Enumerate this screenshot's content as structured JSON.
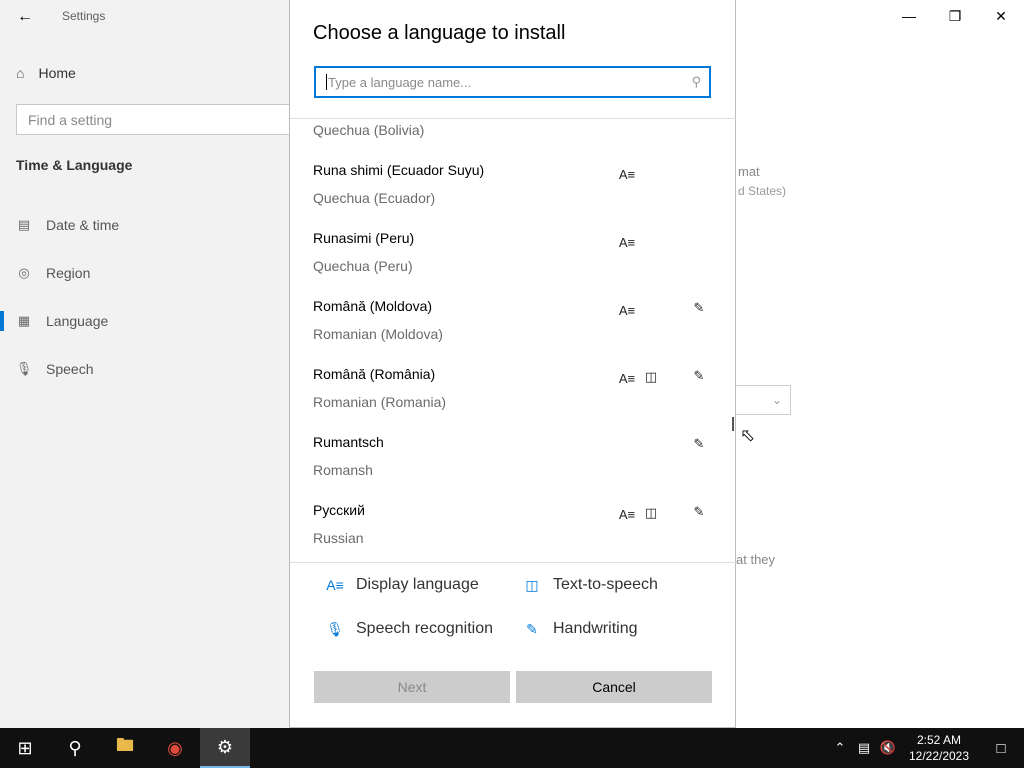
{
  "settings_window": {
    "title": "Settings",
    "nav_home": "Home",
    "search_placeholder": "Find a setting",
    "section_title": "Time & Language",
    "nav_items": [
      {
        "label": "Date & time",
        "icon": "calendar-clock-icon"
      },
      {
        "label": "Region",
        "icon": "globe-icon"
      },
      {
        "label": "Language",
        "icon": "language-icon",
        "selected": true
      },
      {
        "label": "Speech",
        "icon": "microphone-icon"
      }
    ],
    "background_fragments": {
      "format_text": "mat",
      "format_sub": "d States)",
      "body_text": "at they"
    }
  },
  "dialog": {
    "title": "Choose a language to install",
    "search_placeholder": "Type a language name...",
    "partial_item_english": "Quechua (Bolivia)",
    "languages": [
      {
        "native": "Runa shimi (Ecuador Suyu)",
        "english": "Quechua (Ecuador)",
        "display": true,
        "tts": false,
        "handwriting": false
      },
      {
        "native": "Runasimi (Peru)",
        "english": "Quechua (Peru)",
        "display": true,
        "tts": false,
        "handwriting": false
      },
      {
        "native": "Română (Moldova)",
        "english": "Romanian (Moldova)",
        "display": true,
        "tts": false,
        "handwriting": true
      },
      {
        "native": "Română (România)",
        "english": "Romanian (Romania)",
        "display": true,
        "tts": true,
        "handwriting": true
      },
      {
        "native": "Rumantsch",
        "english": "Romansh",
        "display": false,
        "tts": false,
        "handwriting": true
      },
      {
        "native": "Русский",
        "english": "Russian",
        "display": true,
        "tts": true,
        "handwriting": true
      }
    ],
    "legend": {
      "display_language": "Display language",
      "text_to_speech": "Text-to-speech",
      "speech_recognition": "Speech recognition",
      "handwriting": "Handwriting"
    },
    "buttons": {
      "next": "Next",
      "cancel": "Cancel"
    }
  },
  "taskbar": {
    "time": "2:52 AM",
    "date": "12/22/2023"
  },
  "colors": {
    "accent": "#0078d7",
    "sidebar_bg": "#f2f2f2",
    "taskbar_bg": "#101010",
    "button_bg": "#cccccc"
  }
}
